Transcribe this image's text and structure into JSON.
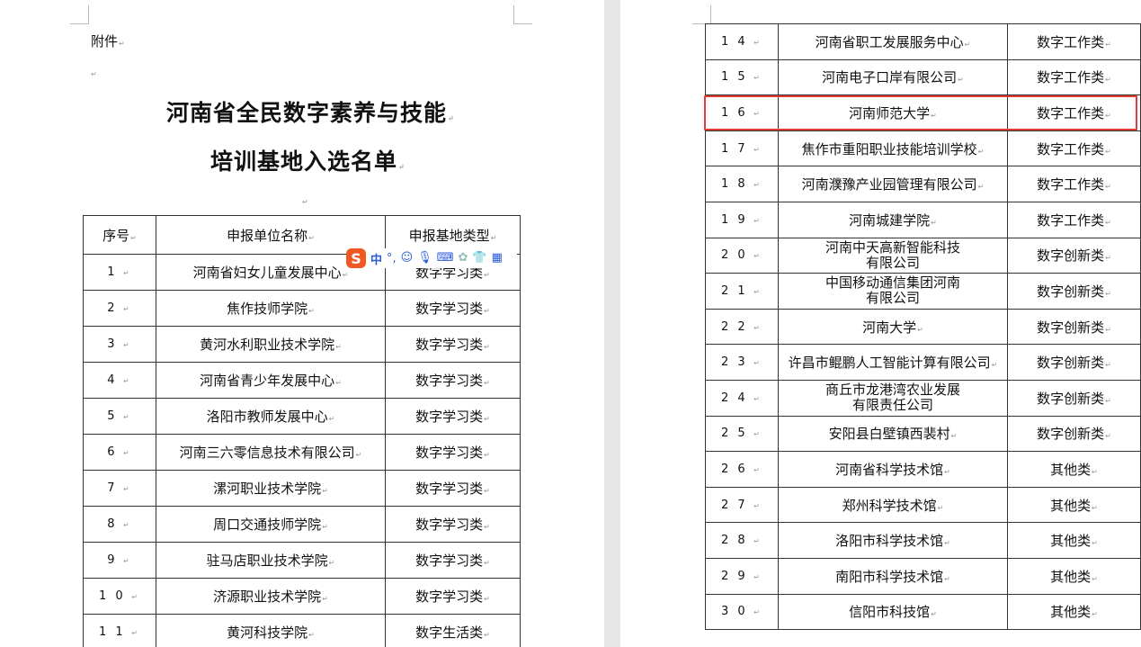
{
  "left_page": {
    "attachment_label": "附件",
    "title_line1": "河南省全民数字素养与技能",
    "title_line2": "培训基地入选名单",
    "headers": [
      "序号",
      "申报单位名称",
      "申报基地类型"
    ],
    "rows": [
      {
        "no": "1",
        "name": "河南省妇女儿童发展中心",
        "type": "数字学习类"
      },
      {
        "no": "2",
        "name": "焦作技师学院",
        "type": "数字学习类"
      },
      {
        "no": "3",
        "name": "黄河水利职业技术学院",
        "type": "数字学习类"
      },
      {
        "no": "4",
        "name": "河南省青少年发展中心",
        "type": "数字学习类"
      },
      {
        "no": "5",
        "name": "洛阳市教师发展中心",
        "type": "数字学习类"
      },
      {
        "no": "6",
        "name": "河南三六零信息技术有限公司",
        "type": "数字学习类"
      },
      {
        "no": "7",
        "name": "漯河职业技术学院",
        "type": "数字学习类"
      },
      {
        "no": "8",
        "name": "周口交通技师学院",
        "type": "数字学习类"
      },
      {
        "no": "9",
        "name": "驻马店职业技术学院",
        "type": "数字学习类"
      },
      {
        "no": "10",
        "name": "济源职业技术学院",
        "type": "数字学习类"
      },
      {
        "no": "11",
        "name": "黄河科技学院",
        "type": "数字生活类"
      }
    ]
  },
  "right_page": {
    "rows": [
      {
        "no": "14",
        "name": "河南省职工发展服务中心",
        "type": "数字工作类"
      },
      {
        "no": "15",
        "name": "河南电子口岸有限公司",
        "type": "数字工作类"
      },
      {
        "no": "16",
        "name": "河南师范大学",
        "type": "数字工作类"
      },
      {
        "no": "17",
        "name": "焦作市重阳职业技能培训学校",
        "type": "数字工作类"
      },
      {
        "no": "18",
        "name": "河南濮豫产业园管理有限公司",
        "type": "数字工作类"
      },
      {
        "no": "19",
        "name": "河南城建学院",
        "type": "数字工作类"
      },
      {
        "no": "20",
        "name": "河南中天高新智能科技",
        "name2": "有限公司",
        "type": "数字创新类"
      },
      {
        "no": "21",
        "name": "中国移动通信集团河南",
        "name2": "有限公司",
        "type": "数字创新类"
      },
      {
        "no": "22",
        "name": "河南大学",
        "type": "数字创新类"
      },
      {
        "no": "23",
        "name": "许昌市鲲鹏人工智能计算有限公司",
        "type": "数字创新类"
      },
      {
        "no": "24",
        "name": "商丘市龙港湾农业发展",
        "name2": "有限责任公司",
        "type": "数字创新类"
      },
      {
        "no": "25",
        "name": "安阳县白壁镇西裴村",
        "type": "数字创新类"
      },
      {
        "no": "26",
        "name": "河南省科学技术馆",
        "type": "其他类"
      },
      {
        "no": "27",
        "name": "郑州科学技术馆",
        "type": "其他类"
      },
      {
        "no": "28",
        "name": "洛阳市科学技术馆",
        "type": "其他类"
      },
      {
        "no": "29",
        "name": "南阳市科学技术馆",
        "type": "其他类"
      },
      {
        "no": "30",
        "name": "信阳市科技馆",
        "type": "其他类"
      }
    ],
    "highlight_row_no": "16",
    "highlight_color": "#e53935"
  },
  "ime_toolbar": {
    "logo": "S",
    "mode_label": "中",
    "punct_label": "°,",
    "icons": [
      "emoji-icon",
      "microphone-icon",
      "keyboard-icon",
      "toolbox-icon",
      "skin-icon",
      "grid-icon"
    ],
    "accent": "#f05a22"
  }
}
